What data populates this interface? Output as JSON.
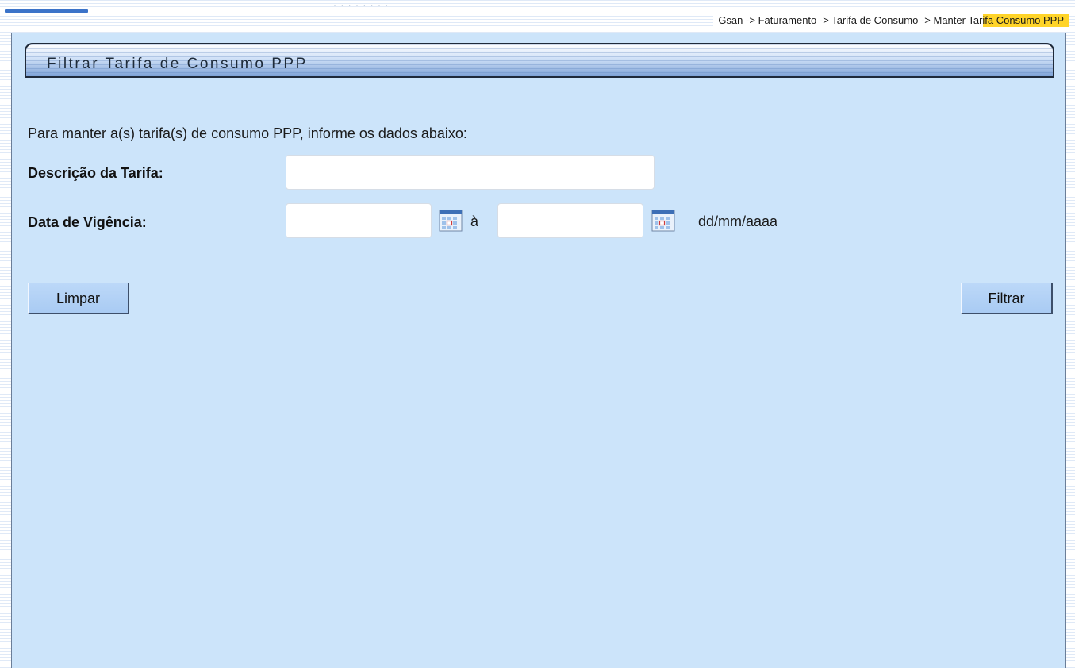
{
  "header": {
    "breadcrumb": {
      "root": "Gsan",
      "module": "Faturamento",
      "section": "Tarifa de Consumo",
      "page": "Manter Tarifa Consumo PPP",
      "separator": "->"
    }
  },
  "panel": {
    "title": "Filtrar Tarifa de Consumo PPP",
    "intro": "Para manter a(s) tarifa(s) de consumo PPP, informe os dados abaixo:"
  },
  "form": {
    "descricao": {
      "label": "Descrição da Tarifa:",
      "value": ""
    },
    "vigencia": {
      "label": "Data de Vigência:",
      "start_value": "",
      "end_value": "",
      "between_text": "à",
      "format_hint": "dd/mm/aaaa"
    }
  },
  "buttons": {
    "clear_label": "Limpar",
    "filter_label": "Filtrar"
  },
  "icons": {
    "calendar": "calendar-icon"
  },
  "colors": {
    "panel_bg": "#cce4fa",
    "button_bg": "#a9cbf3",
    "breadcrumb_highlight": "#ffd429",
    "accent": "#3b73c9"
  }
}
